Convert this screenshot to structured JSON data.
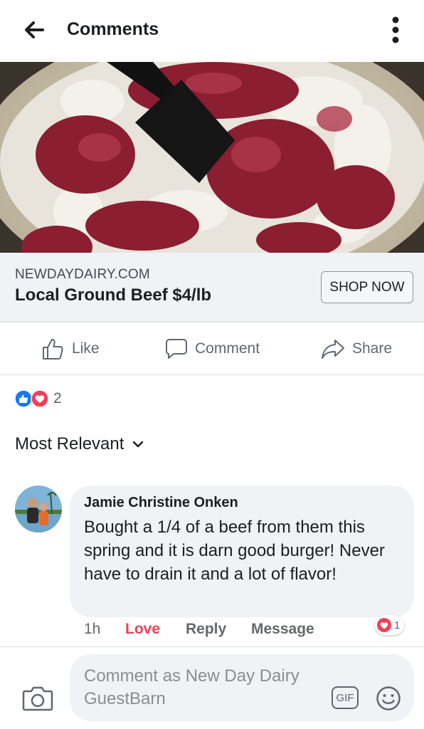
{
  "header": {
    "title": "Comments",
    "back_icon": "arrow-left-icon",
    "more_icon": "vertical-dots-icon"
  },
  "ad": {
    "domain": "NEWDAYDAIRY.COM",
    "title": "Local Ground Beef $4/lb",
    "cta": "SHOP NOW"
  },
  "actions": {
    "like": "Like",
    "comment": "Comment",
    "share": "Share"
  },
  "reactions": {
    "count": "2",
    "types": [
      "like",
      "love"
    ]
  },
  "sort": {
    "label": "Most Relevant"
  },
  "comment": {
    "author": "Jamie Christine Onken",
    "text": "Bought a 1/4 of a beef from them this spring and it is darn good burger! Never have to drain it and a lot of flavor!",
    "time": "1h",
    "reaction_label": "Love",
    "reply": "Reply",
    "message": "Message",
    "love_count": "1"
  },
  "composer": {
    "placeholder": "Comment as New Day Dairy GuestBarn",
    "gif": "GIF"
  },
  "colors": {
    "accent_blue": "#1877f2",
    "love_red": "#f33e58",
    "muted": "#65676b",
    "surface": "#f0f2f5"
  }
}
